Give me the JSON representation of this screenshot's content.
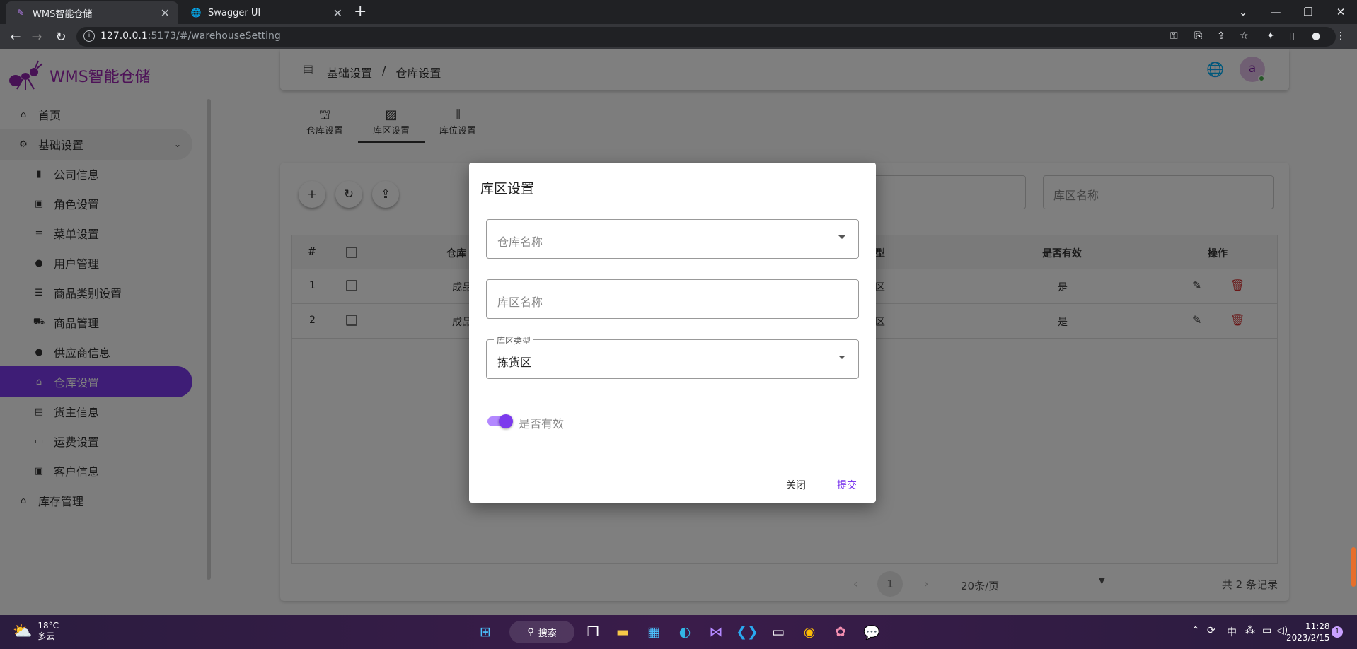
{
  "browser": {
    "tabs": [
      {
        "title": "WMS智能仓储",
        "active": true
      },
      {
        "title": "Swagger UI",
        "active": false
      }
    ],
    "url_host": "127.0.0.1",
    "url_rest": ":5173/#/warehouseSetting"
  },
  "app": {
    "logo_text": "WMS智能仓储",
    "nav": {
      "home": "首页",
      "basic_settings": "基础设置",
      "company_info": "公司信息",
      "role_settings": "角色设置",
      "menu_settings": "菜单设置",
      "user_mgmt": "用户管理",
      "category_settings": "商品类别设置",
      "product_mgmt": "商品管理",
      "supplier_info": "供应商信息",
      "warehouse_settings": "仓库设置",
      "owner_info": "货主信息",
      "freight_settings": "运费设置",
      "customer_info": "客户信息",
      "inventory_mgmt": "库存管理"
    },
    "breadcrumb": {
      "level1": "基础设置",
      "sep": "/",
      "level2": "仓库设置"
    },
    "avatar_letter": "a",
    "subtabs": {
      "warehouse": "仓库设置",
      "area": "库区设置",
      "location": "库位设置"
    },
    "search": {
      "area_name_placeholder": "库区名称"
    },
    "table": {
      "headers": {
        "index": "#",
        "warehouse": "仓库",
        "type": "型",
        "valid": "是否有效",
        "actions": "操作"
      },
      "rows": [
        {
          "index": "1",
          "warehouse": "成品",
          "type": "区",
          "valid": "是"
        },
        {
          "index": "2",
          "warehouse": "成品",
          "type": "区",
          "valid": "是"
        }
      ]
    },
    "pager": {
      "current": "1",
      "page_size": "20条/页",
      "total": "共 2 条记录"
    }
  },
  "dialog": {
    "title": "库区设置",
    "warehouse_name_placeholder": "仓库名称",
    "area_name_placeholder": "库区名称",
    "area_type_label": "库区类型",
    "area_type_value": "拣货区",
    "valid_label": "是否有效",
    "valid_checked": true,
    "close_label": "关闭",
    "submit_label": "提交",
    "accent_color": "#7c3aed"
  },
  "taskbar": {
    "temperature": "18°C",
    "weather": "多云",
    "search_label": "搜索",
    "ime": "中",
    "time": "11:28",
    "date": "2023/2/15",
    "notifications": "1"
  }
}
